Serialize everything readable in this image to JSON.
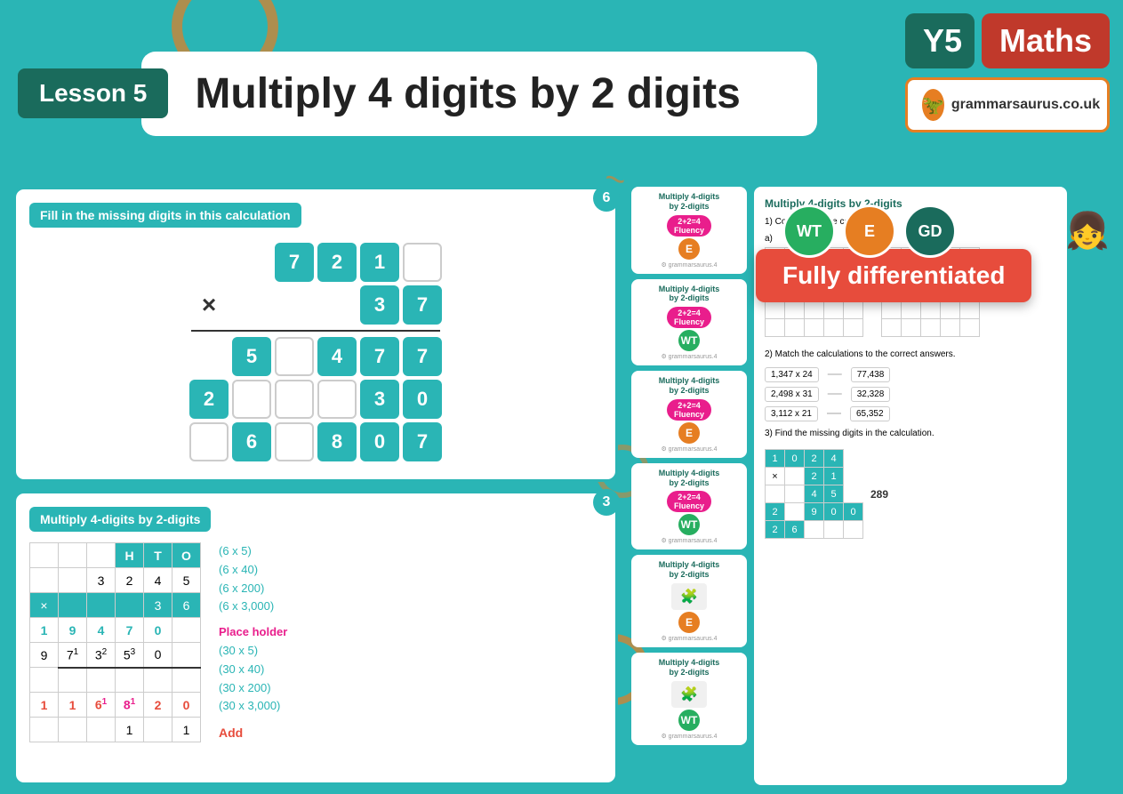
{
  "header": {
    "lesson_label": "Lesson 5",
    "title": "Multiply 4 digits by 2 digits",
    "year": "Y5",
    "subject": "Maths",
    "website": "grammarsaurus.co.uk"
  },
  "slide1": {
    "number": "6",
    "instruction": "Fill in the missing digits in this calculation",
    "rows": [
      [
        "7",
        "2",
        "1",
        ""
      ],
      [
        "x",
        "",
        "",
        "3",
        "7"
      ],
      [
        "5",
        "",
        "4",
        "7",
        "7"
      ],
      [
        "2",
        "",
        "",
        "",
        "3",
        "0"
      ],
      [
        "",
        "6",
        "",
        "8",
        "0",
        "7"
      ]
    ]
  },
  "slide2": {
    "number": "3",
    "title": "Multiply 4-digits by 2-digits",
    "steps": [
      "(6 x 5)",
      "(6 x 40)",
      "(6 x 200)",
      "(6 x 3,000)",
      "Place holder",
      "(30 x 5)",
      "(30 x 40)",
      "(30 x 200)",
      "(30 x 3,000)",
      "Add"
    ]
  },
  "fully_differentiated": {
    "text": "Fully differentiated",
    "badges": [
      "WT",
      "E",
      "GD"
    ]
  },
  "worksheets": [
    {
      "title": "Multiply 4-digits by 2-digits",
      "badge_text": "2+2=4 Fluency",
      "level": "E"
    },
    {
      "title": "Multiply 4-digits by 2-digits",
      "badge_text": "2+2=4 Fluency",
      "level": "WT"
    },
    {
      "title": "Multiply 4-digits by 2-digits",
      "badge_text": "2+2=4 Fluency",
      "level": "E"
    },
    {
      "title": "Multiply 4-digits by 2-digits",
      "badge_text": "2+2=4 Fluency",
      "level": "WT"
    },
    {
      "title": "Multiply 4-digits by 2-digits",
      "icon": "puzzle",
      "level": "E"
    },
    {
      "title": "Multiply 4-digits by 2-digits",
      "icon": "puzzle",
      "level": "WT"
    }
  ],
  "worksheet_preview": {
    "title": "Multiply 4-digits by 2-digits",
    "q1": "1) Complete these calculations.",
    "q2": "2) Match the calculations to the correct answers.",
    "q3": "3) Find the missing digits in the calculation.",
    "matches": [
      {
        "left": "1,347 x 24",
        "right": "77,438"
      },
      {
        "left": "2,498 x 31",
        "right": "32,328"
      },
      {
        "left": "3,112 x 21",
        "right": "65,352"
      }
    ],
    "missing_digits": {
      "top_row": [
        "1",
        "0",
        "2",
        "4"
      ],
      "mult_row": [
        "",
        "",
        "2",
        "1"
      ],
      "row1": [
        "",
        "",
        "4",
        "5"
      ],
      "row2": [
        "2",
        "",
        "9",
        "0",
        "0"
      ],
      "row3": [
        "2",
        "6",
        "",
        "",
        ""
      ]
    }
  }
}
